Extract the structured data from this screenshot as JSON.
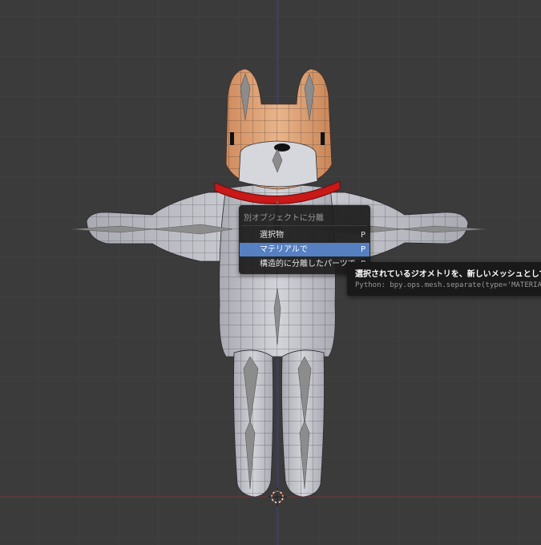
{
  "viewport": {
    "grid_color": "#444444",
    "x_axis_color": "#7a3535",
    "y_axis_color": "#3a3ab0",
    "mesh_body_color": "#c5c6cc",
    "mesh_head_color": "#e2a576",
    "collar_color": "#c81818",
    "bone_color": "#8c8c8c"
  },
  "menu": {
    "title": "別オブジェクトに分離",
    "items": [
      {
        "label": "選択物",
        "shortcut": "P",
        "active": false
      },
      {
        "label": "マテリアルで",
        "shortcut": "P",
        "active": true
      },
      {
        "label": "構造的に分離したパーツで",
        "shortcut": "P",
        "active": false
      }
    ],
    "highlight_color": "#5680c2"
  },
  "tooltip": {
    "title": "選択されているジオメトリを、新しいメッシュとして分離します",
    "python": "Python: bpy.ops.mesh.separate(type='MATERIAL')"
  }
}
